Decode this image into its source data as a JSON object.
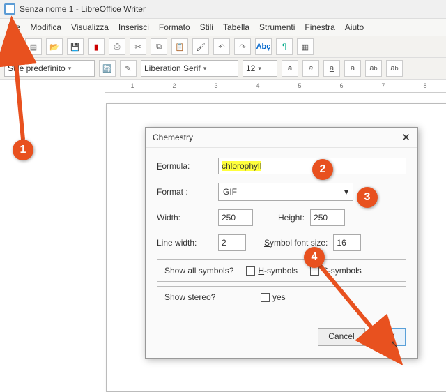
{
  "title": "Senza nome 1 - LibreOffice Writer",
  "menu": [
    "File",
    "Modifica",
    "Visualizza",
    "Inserisci",
    "Formato",
    "Stili",
    "Tabella",
    "Strumenti",
    "Finestra",
    "Aiuto"
  ],
  "style_combo": "Stile predefinito",
  "font_combo": "Liberation Serif",
  "size_combo": "12",
  "dialog": {
    "title": "Chemestry",
    "formula_lbl": "Formula:",
    "formula_val": "chlorophyll",
    "format_lbl": "Format :",
    "format_val": "GIF",
    "width_lbl": "Width:",
    "width_val": "250",
    "height_lbl": "Height:",
    "height_val": "250",
    "linew_lbl": "Line width:",
    "linew_val": "2",
    "symfs_lbl": "Symbol font size:",
    "symfs_val": "16",
    "showall_lbl": "Show all symbols?",
    "hsym_lbl": "H-symbols",
    "csym_lbl": "C-symbols",
    "stereo_lbl": "Show stereo?",
    "yes_lbl": "yes",
    "cancel": "Cancel",
    "ok": "OK"
  },
  "steps": {
    "1": "1",
    "2": "2",
    "3": "3",
    "4": "4"
  }
}
